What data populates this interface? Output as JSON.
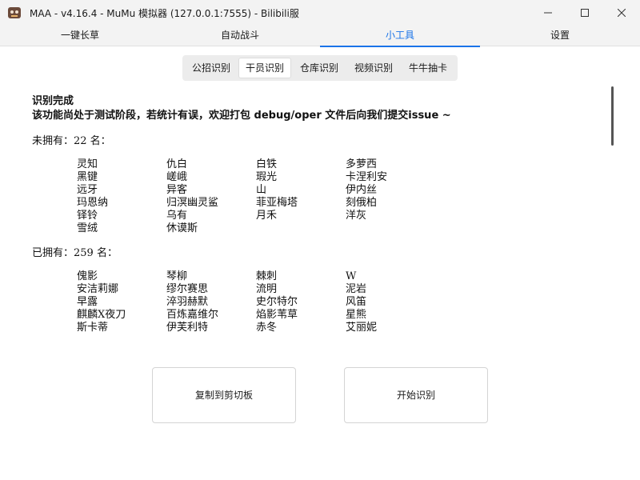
{
  "window": {
    "title": "MAA - v4.16.4 - MuMu 模拟器 (127.0.0.1:7555) - Bilibili服",
    "icons": [
      "app-icon",
      "minimize-icon",
      "maximize-icon",
      "close-icon"
    ]
  },
  "main_tabs": [
    {
      "label": "一键长草",
      "active": false
    },
    {
      "label": "自动战斗",
      "active": false
    },
    {
      "label": "小工具",
      "active": true
    },
    {
      "label": "设置",
      "active": false
    }
  ],
  "sub_tabs": [
    {
      "label": "公招识别",
      "active": false
    },
    {
      "label": "干员识别",
      "active": true
    },
    {
      "label": "仓库识别",
      "active": false
    },
    {
      "label": "视频识别",
      "active": false
    },
    {
      "label": "牛牛抽卡",
      "active": false
    }
  ],
  "result": {
    "status": "识别完成",
    "notice": "该功能尚处于测试阶段，若统计有误，欢迎打包 debug/oper 文件后向我们提交issue ~",
    "not_owned": {
      "heading": "未拥有：22 名：",
      "names": [
        "灵知",
        "仇白",
        "白铁",
        "多萝西",
        "黑键",
        "嵯峨",
        "瑕光",
        "卡涅利安",
        "远牙",
        "异客",
        "山",
        "伊内丝",
        "玛恩纳",
        "归溟幽灵鲨",
        "菲亚梅塔",
        "刻俄柏",
        "铎铃",
        "乌有",
        "月禾",
        "洋灰",
        "雪绒",
        "休谟斯"
      ]
    },
    "owned": {
      "heading": "已拥有：259 名：",
      "names": [
        "傀影",
        "琴柳",
        "棘刺",
        "W",
        "安洁莉娜",
        "缪尔赛思",
        "流明",
        "泥岩",
        "早露",
        "淬羽赫默",
        "史尔特尔",
        "风笛",
        "麒麟X夜刀",
        "百炼嘉维尔",
        "焰影苇草",
        "星熊",
        "斯卡蒂",
        "伊芙利特",
        "赤冬",
        "艾丽妮"
      ]
    }
  },
  "buttons": {
    "copy": "复制到剪切板",
    "start": "开始识别"
  },
  "colors": {
    "accent": "#1a73e8",
    "titlebar_bg": "#f3f3f3"
  }
}
